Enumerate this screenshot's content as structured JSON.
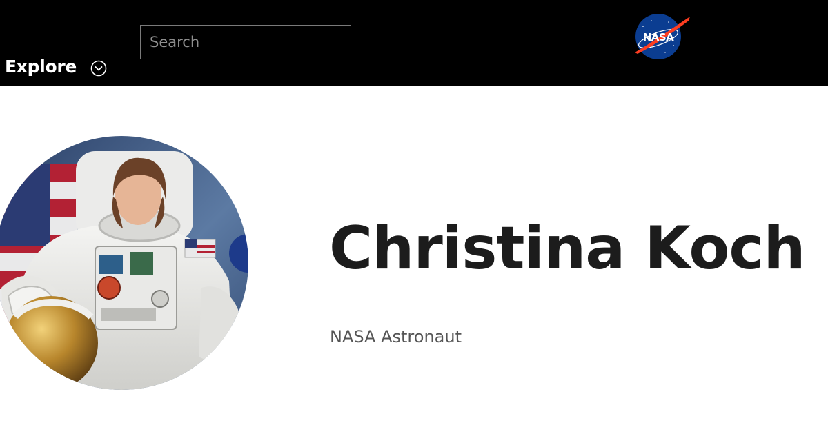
{
  "header": {
    "explore_label": "Explore",
    "explore_icon": "chevron-down-circle-icon",
    "search": {
      "placeholder": "Search",
      "value": ""
    },
    "logo": {
      "text": "NASA",
      "icon": "nasa-meatball-logo"
    },
    "background_color": "#000000"
  },
  "profile": {
    "name": "Christina Koch",
    "title": "NASA Astronaut",
    "photo": {
      "subject": "astronaut-portrait"
    }
  },
  "colors": {
    "name_text": "#1c1c1c",
    "title_text": "#555555",
    "nasa_blue": "#0b3d91",
    "nasa_red": "#fc3d21"
  }
}
